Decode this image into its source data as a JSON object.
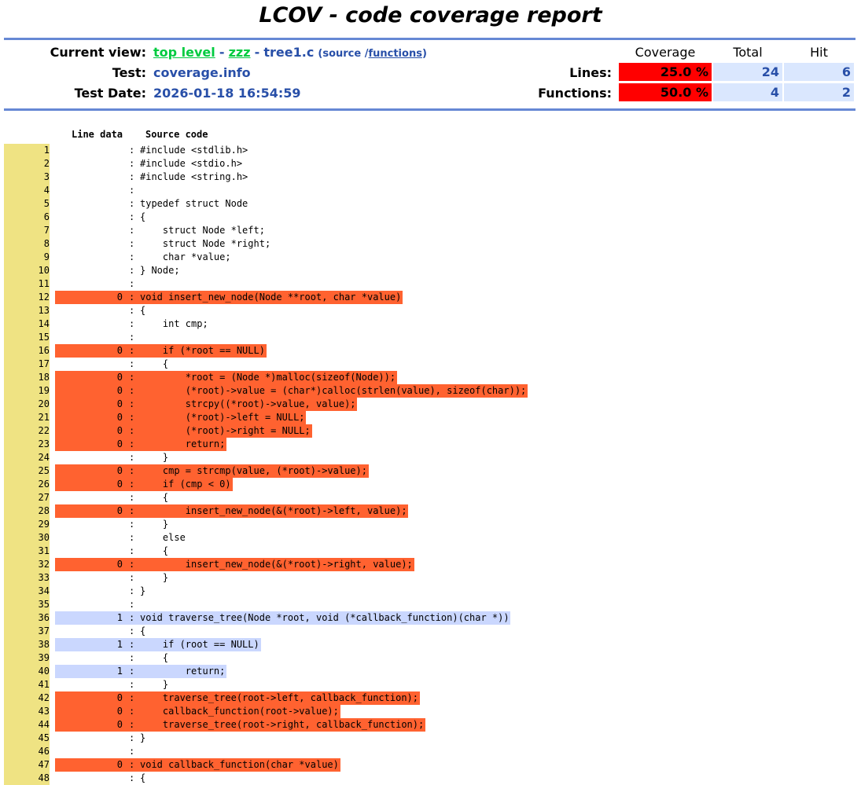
{
  "title": "LCOV - code coverage report",
  "header": {
    "current_view_label": "Current view:",
    "crumb_top": "top level",
    "crumb_sep1": "-",
    "crumb_dir": "zzz",
    "crumb_sep2": "-",
    "crumb_file": "tree1.c",
    "view_open": "(source /",
    "view_functions": "functions",
    "view_close": ")",
    "test_label": "Test:",
    "test_value": "coverage.info",
    "date_label": "Test Date:",
    "date_value": "2026-01-18 16:54:59"
  },
  "summary": {
    "col_coverage": "Coverage",
    "col_total": "Total",
    "col_hit": "Hit",
    "lines_label": "Lines:",
    "lines_coverage": "25.0 %",
    "lines_total": "24",
    "lines_hit": "6",
    "functions_label": "Functions:",
    "functions_coverage": "50.0 %",
    "functions_total": "4",
    "functions_hit": "2",
    "colors": {
      "low": "#ff0000",
      "missed_line": "#ff6230",
      "hit_line": "#cad7fe",
      "line_number": "#efe383"
    }
  },
  "source": {
    "col_line_data": "Line data",
    "col_source_code": "Source code",
    "lines": [
      {
        "n": "1",
        "count": "",
        "status": "none",
        "code": "#include <stdlib.h>"
      },
      {
        "n": "2",
        "count": "",
        "status": "none",
        "code": "#include <stdio.h>"
      },
      {
        "n": "3",
        "count": "",
        "status": "none",
        "code": "#include <string.h>"
      },
      {
        "n": "4",
        "count": "",
        "status": "none",
        "code": ""
      },
      {
        "n": "5",
        "count": "",
        "status": "none",
        "code": "typedef struct Node"
      },
      {
        "n": "6",
        "count": "",
        "status": "none",
        "code": "{"
      },
      {
        "n": "7",
        "count": "",
        "status": "none",
        "code": "    struct Node *left;"
      },
      {
        "n": "8",
        "count": "",
        "status": "none",
        "code": "    struct Node *right;"
      },
      {
        "n": "9",
        "count": "",
        "status": "none",
        "code": "    char *value;"
      },
      {
        "n": "10",
        "count": "",
        "status": "none",
        "code": "} Node;"
      },
      {
        "n": "11",
        "count": "",
        "status": "none",
        "code": ""
      },
      {
        "n": "12",
        "count": "0",
        "status": "miss",
        "code": "void insert_new_node(Node **root, char *value)"
      },
      {
        "n": "13",
        "count": "",
        "status": "none",
        "code": "{"
      },
      {
        "n": "14",
        "count": "",
        "status": "none",
        "code": "    int cmp;"
      },
      {
        "n": "15",
        "count": "",
        "status": "none",
        "code": ""
      },
      {
        "n": "16",
        "count": "0",
        "status": "miss",
        "code": "    if (*root == NULL)"
      },
      {
        "n": "17",
        "count": "",
        "status": "none",
        "code": "    {"
      },
      {
        "n": "18",
        "count": "0",
        "status": "miss",
        "code": "        *root = (Node *)malloc(sizeof(Node));"
      },
      {
        "n": "19",
        "count": "0",
        "status": "miss",
        "code": "        (*root)->value = (char*)calloc(strlen(value), sizeof(char));"
      },
      {
        "n": "20",
        "count": "0",
        "status": "miss",
        "code": "        strcpy((*root)->value, value);"
      },
      {
        "n": "21",
        "count": "0",
        "status": "miss",
        "code": "        (*root)->left = NULL;"
      },
      {
        "n": "22",
        "count": "0",
        "status": "miss",
        "code": "        (*root)->right = NULL;"
      },
      {
        "n": "23",
        "count": "0",
        "status": "miss",
        "code": "        return;"
      },
      {
        "n": "24",
        "count": "",
        "status": "none",
        "code": "    }"
      },
      {
        "n": "25",
        "count": "0",
        "status": "miss",
        "code": "    cmp = strcmp(value, (*root)->value);"
      },
      {
        "n": "26",
        "count": "0",
        "status": "miss",
        "code": "    if (cmp < 0)"
      },
      {
        "n": "27",
        "count": "",
        "status": "none",
        "code": "    {"
      },
      {
        "n": "28",
        "count": "0",
        "status": "miss",
        "code": "        insert_new_node(&(*root)->left, value);"
      },
      {
        "n": "29",
        "count": "",
        "status": "none",
        "code": "    }"
      },
      {
        "n": "30",
        "count": "",
        "status": "none",
        "code": "    else"
      },
      {
        "n": "31",
        "count": "",
        "status": "none",
        "code": "    {"
      },
      {
        "n": "32",
        "count": "0",
        "status": "miss",
        "code": "        insert_new_node(&(*root)->right, value);"
      },
      {
        "n": "33",
        "count": "",
        "status": "none",
        "code": "    }"
      },
      {
        "n": "34",
        "count": "",
        "status": "none",
        "code": "}"
      },
      {
        "n": "35",
        "count": "",
        "status": "none",
        "code": ""
      },
      {
        "n": "36",
        "count": "1",
        "status": "hit",
        "code": "void traverse_tree(Node *root, void (*callback_function)(char *))"
      },
      {
        "n": "37",
        "count": "",
        "status": "none",
        "code": "{"
      },
      {
        "n": "38",
        "count": "1",
        "status": "hit",
        "code": "    if (root == NULL)"
      },
      {
        "n": "39",
        "count": "",
        "status": "none",
        "code": "    {"
      },
      {
        "n": "40",
        "count": "1",
        "status": "hit",
        "code": "        return;"
      },
      {
        "n": "41",
        "count": "",
        "status": "none",
        "code": "    }"
      },
      {
        "n": "42",
        "count": "0",
        "status": "miss",
        "code": "    traverse_tree(root->left, callback_function);"
      },
      {
        "n": "43",
        "count": "0",
        "status": "miss",
        "code": "    callback_function(root->value);"
      },
      {
        "n": "44",
        "count": "0",
        "status": "miss",
        "code": "    traverse_tree(root->right, callback_function);"
      },
      {
        "n": "45",
        "count": "",
        "status": "none",
        "code": "}"
      },
      {
        "n": "46",
        "count": "",
        "status": "none",
        "code": ""
      },
      {
        "n": "47",
        "count": "0",
        "status": "miss",
        "code": "void callback_function(char *value)"
      },
      {
        "n": "48",
        "count": "",
        "status": "none",
        "code": "{"
      }
    ]
  }
}
